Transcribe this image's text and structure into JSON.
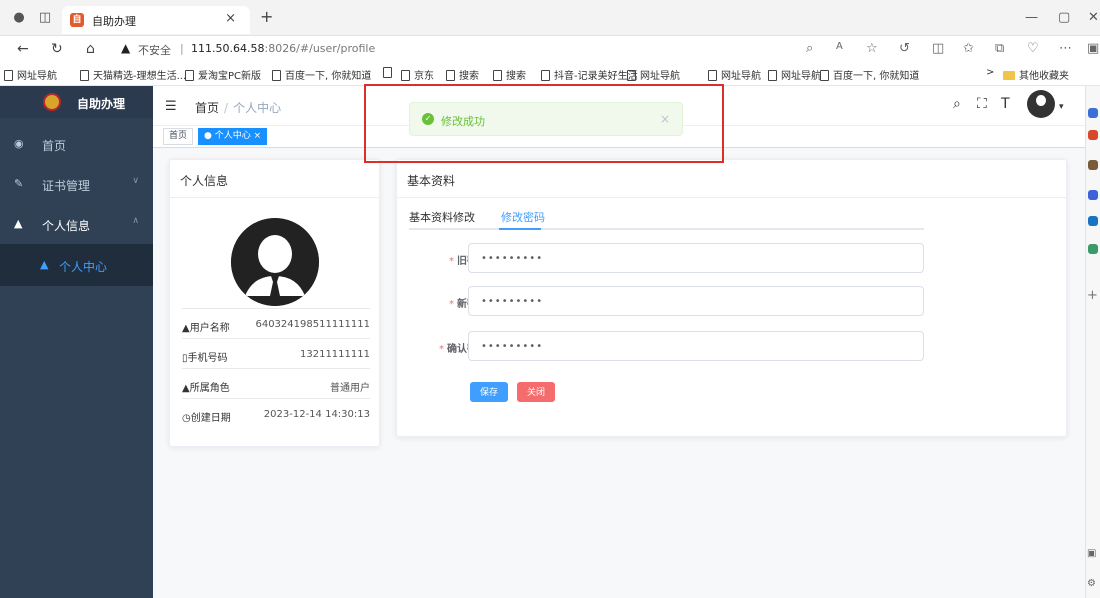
{
  "browser": {
    "tab_title": "自助办理",
    "tab_close": "×",
    "new_tab": "+",
    "insecure_label": "不安全",
    "url_host": "111.50.64.58",
    "url_rest": ":8026/#/user/profile",
    "bookmarks": [
      "网址导航",
      "天猫精选-理想生活...",
      "爱淘宝PC新版",
      "百度一下, 你就知道",
      "",
      "京东",
      "搜索",
      "搜索",
      "抖音-记录美好生活",
      "网址导航",
      "网址导航",
      "网址导航",
      "百度一下, 你就知道"
    ],
    "other_bookmarks": "其他收藏夹"
  },
  "app": {
    "logo_title": "自助办理",
    "menu": {
      "home": "首页",
      "certificate": "证书管理",
      "personal": "个人信息",
      "user_center": "个人中心"
    },
    "breadcrumb": {
      "home": "首页",
      "separator": "/",
      "current": "个人中心"
    },
    "tags": {
      "home": "首页",
      "current": "● 个人中心 ×"
    }
  },
  "profile_card": {
    "title": "个人信息",
    "rows": [
      {
        "label": "用户名称",
        "value": "640324198511111111"
      },
      {
        "label": "手机号码",
        "value": "13211111111"
      },
      {
        "label": "所属角色",
        "value": "普通用户"
      },
      {
        "label": "创建日期",
        "value": "2023-12-14 14:30:13"
      }
    ]
  },
  "basic_card": {
    "title": "基本资料",
    "tabs": {
      "basic": "基本资料修改",
      "password": "修改密码"
    },
    "fields": {
      "old_label": "旧密码",
      "old_value": "•••••••••",
      "new_label": "新密码",
      "new_value": "•••••••••",
      "confirm_label": "确认密码",
      "confirm_value": "•••••••••"
    },
    "save_button": "保存",
    "close_button": "关闭"
  },
  "toast": {
    "message": "修改成功",
    "close": "×"
  },
  "colors": {
    "sidebar": "#304156",
    "primary": "#409eff",
    "danger": "#f56c6c",
    "success": "#67c23a",
    "highlight": "#d9302c"
  }
}
